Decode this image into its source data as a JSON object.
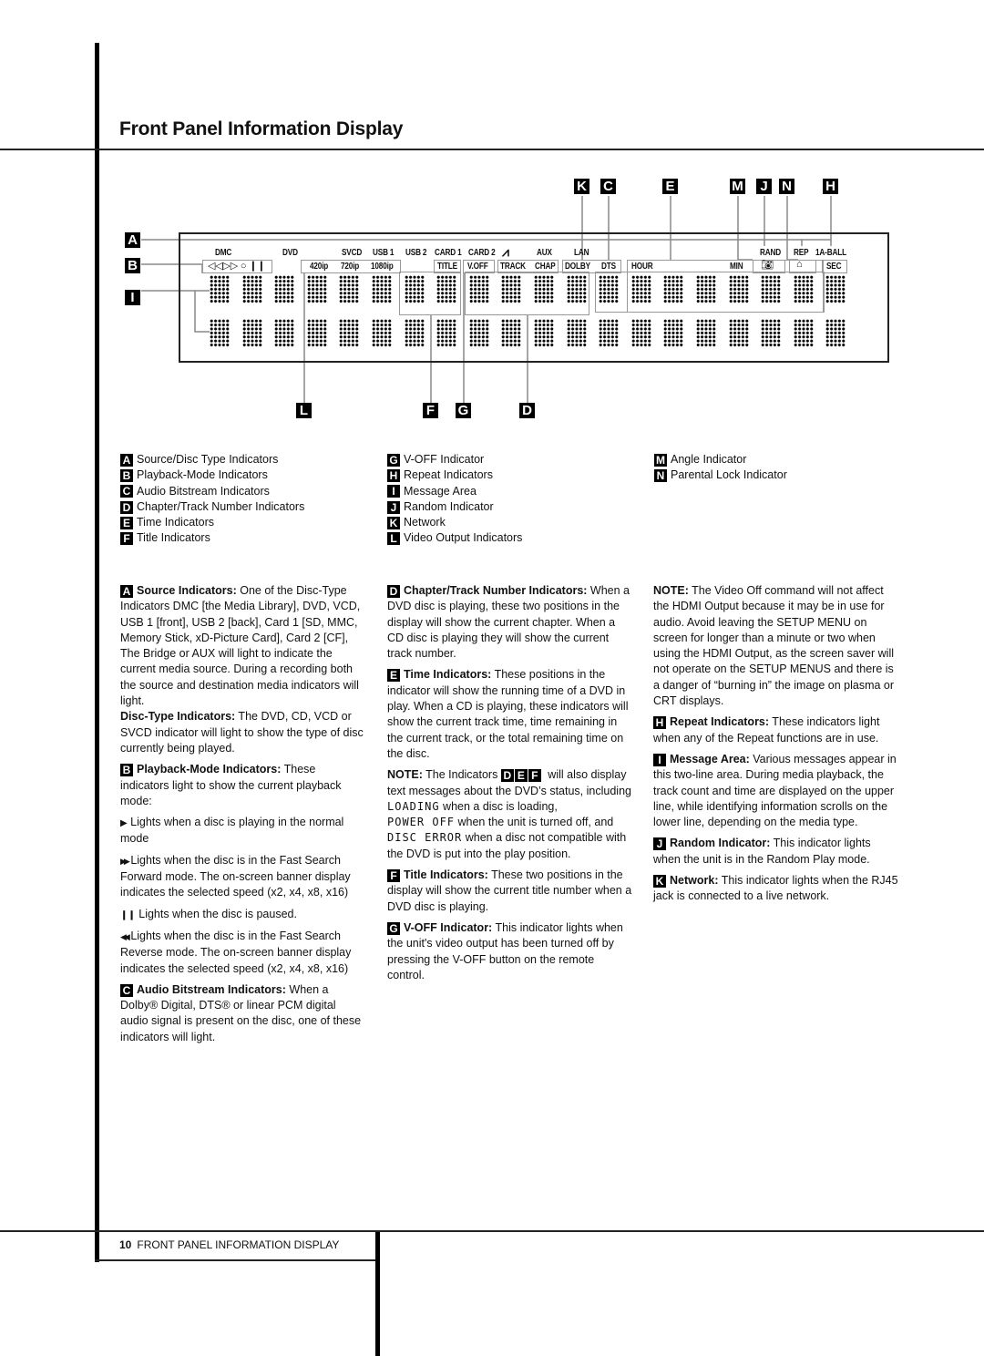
{
  "page": {
    "title": "Front Panel Information Display",
    "footer": {
      "page_number": "10",
      "section": "FRONT PANEL INFORMATION DISPLAY"
    }
  },
  "diagram": {
    "callouts_top": [
      "K",
      "C",
      "E",
      "M",
      "J",
      "N",
      "H"
    ],
    "callouts_left": [
      "A",
      "B",
      "I"
    ],
    "callouts_bottom": [
      "L",
      "F",
      "G",
      "D"
    ],
    "source_row": [
      "DMC",
      "DVD",
      "SVCD",
      "USB 1",
      "USB 2",
      "CARD 1",
      "CARD 2",
      "AUX",
      "LAN",
      "RAND",
      "REP",
      "1A-BALL"
    ],
    "playback_icons": "◁◁▷▷  ○ ❙❙",
    "video_output": [
      "420ip",
      "720ip",
      "1080ip"
    ],
    "row2_labels": [
      "TITLE",
      "V.OFF",
      "TRACK",
      "CHAP",
      "DOLBY",
      "DTS",
      "HOUR",
      "MIN",
      "SEC"
    ],
    "bridge_icon": "bridge-icon",
    "angle_icon": "camera-angle-icon",
    "lock_icon": "padlock-icon"
  },
  "legend": {
    "col1": [
      {
        "key": "A",
        "label": "Source/Disc Type Indicators"
      },
      {
        "key": "B",
        "label": "Playback-Mode Indicators"
      },
      {
        "key": "C",
        "label": "Audio Bitstream Indicators"
      },
      {
        "key": "D",
        "label": "Chapter/Track Number Indicators"
      },
      {
        "key": "E",
        "label": "Time Indicators"
      },
      {
        "key": "F",
        "label": "Title Indicators"
      }
    ],
    "col2": [
      {
        "key": "G",
        "label": "V-OFF Indicator"
      },
      {
        "key": "H",
        "label": "Repeat Indicators"
      },
      {
        "key": "I",
        "label": "Message Area"
      },
      {
        "key": "J",
        "label": "Random Indicator"
      },
      {
        "key": "K",
        "label": "Network"
      },
      {
        "key": "L",
        "label": "Video Output Indicators"
      }
    ],
    "col3": [
      {
        "key": "M",
        "label": "Angle Indicator"
      },
      {
        "key": "N",
        "label": "Parental Lock Indicator"
      }
    ]
  },
  "body": {
    "col1": {
      "a_key": "A",
      "a_head": "Source Indicators:",
      "a_text": " One of the Disc-Type Indicators DMC [the Media Library], DVD, VCD, USB 1 [front], USB 2 [back], Card 1 [SD, MMC, Memory Stick, xD-Picture Card], Card 2 [CF], The Bridge or AUX will light to indicate the current media source. During a recording both the source and destination media indicators will light.",
      "disc_head": "Disc-Type Indicators:",
      "disc_text": " The DVD, CD, VCD or SVCD indicator will light to show the type of disc currently being played.",
      "b_key": "B",
      "b_head": "Playback-Mode Indicators:",
      "b_text": " These indicators light to show the current playback mode:",
      "play_icon": "▶",
      "play_text": " Lights when a disc is playing in the normal mode",
      "ff_icon": "▶▶",
      "ff_text": " Lights when the disc is in the Fast Search Forward mode. The on-screen banner display indicates the selected speed (x2, x4, x8, x16)",
      "pause_icon": "❙❙",
      "pause_text": " Lights when the disc is paused.",
      "rew_icon": "◀◀",
      "rew_text": " Lights when the disc is in the Fast Search Reverse mode. The on-screen banner display indicates the selected speed (x2, x4, x8, x16)",
      "c_key": "C",
      "c_head": "Audio Bitstream Indicators:",
      "c_text": " When a Dolby® Digital, DTS® or linear PCM digital audio signal is present on the disc, one of these indicators will light."
    },
    "col2": {
      "d_key": "D",
      "d_head": "Chapter/Track Number Indicators:",
      "d_text": " When a DVD disc is playing, these two positions in the display will show the current chapter. When a CD disc is playing they will show the current track number.",
      "e_key": "E",
      "e_head": "Time Indicators:",
      "e_text": " These positions in the indicator will show the running time of a DVD in play. When a CD is playing, these indicators will show the current track time, time remaining in the current track, or the total remaining time on the disc.",
      "note_head": "NOTE:",
      "note_pre": " The Indicators ",
      "note_keys": [
        "D",
        "E",
        "F"
      ],
      "note_mid": " will also display text messages about the DVD’s status, including ",
      "msg_loading": "LOADING",
      "msg_loading_text": " when a disc is loading,",
      "msg_power": "POWER OFF",
      "msg_power_text": " when the unit is turned off, and",
      "msg_error": "DISC ERROR",
      "msg_error_text": " when a disc not compatible with the DVD is put into the play position.",
      "f_key": "F",
      "f_head": "Title Indicators:",
      "f_text": " These two positions in the display will show the current title number when a DVD disc is playing.",
      "g_key": "G",
      "g_head": "V-OFF Indicator:",
      "g_text": " This indicator lights when the unit's video output has been turned off by pressing the V-OFF button on the remote control."
    },
    "col3": {
      "note_head": "NOTE:",
      "note_text": " The Video Off command will not affect the HDMI Output because it may be in use for audio. Avoid leaving the SETUP MENU on screen for longer than a minute or two when using the HDMI Output, as the screen saver will not operate on the SETUP MENUS and there is a danger of “burning in” the image on plasma or CRT displays.",
      "h_key": "H",
      "h_head": "Repeat Indicators:",
      "h_text": " These indicators light when any of the Repeat functions are in use.",
      "i_key": "I",
      "i_head": "Message Area:",
      "i_text": " Various messages appear in this two-line area. During media playback, the track count and time are displayed on the upper line, while identifying information scrolls on the lower line, depending on the media type.",
      "j_key": "J",
      "j_head": "Random Indicator:",
      "j_text": " This indicator lights when the unit is in the Random Play mode.",
      "k_key": "K",
      "k_head": "Network:",
      "k_text": " This indicator lights when the RJ45 jack is connected to a live network."
    }
  }
}
